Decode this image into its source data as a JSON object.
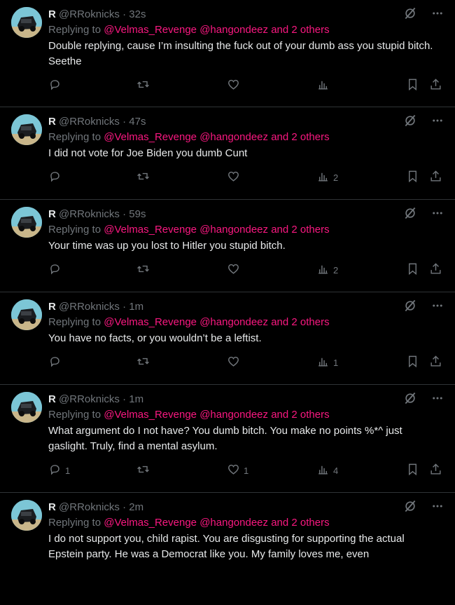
{
  "tweets": [
    {
      "name": "R",
      "handle": "@RRoknicks",
      "sep": "·",
      "time": "32s",
      "replying_prefix": "Replying to",
      "mention1": "@Velmas_Revenge",
      "mention2": "@hangondeez",
      "others": "and 2 others",
      "text": "Double replying, cause I’m insulting the fuck out of your dumb ass you stupid bitch. Seethe",
      "replies": "",
      "likes": "",
      "views": ""
    },
    {
      "name": "R",
      "handle": "@RRoknicks",
      "sep": "·",
      "time": "47s",
      "replying_prefix": "Replying to",
      "mention1": "@Velmas_Revenge",
      "mention2": "@hangondeez",
      "others": "and 2 others",
      "text": "I did not vote for Joe Biden you dumb Cunt",
      "replies": "",
      "likes": "",
      "views": "2"
    },
    {
      "name": "R",
      "handle": "@RRoknicks",
      "sep": "·",
      "time": "59s",
      "replying_prefix": "Replying to",
      "mention1": "@Velmas_Revenge",
      "mention2": "@hangondeez",
      "others": "and 2 others",
      "text": "Your time was up you lost to Hitler you stupid bitch.",
      "replies": "",
      "likes": "",
      "views": "2"
    },
    {
      "name": "R",
      "handle": "@RRoknicks",
      "sep": "·",
      "time": "1m",
      "replying_prefix": "Replying to",
      "mention1": "@Velmas_Revenge",
      "mention2": "@hangondeez",
      "others": "and 2 others",
      "text": "You have no facts, or you wouldn’t be a leftist.",
      "replies": "",
      "likes": "",
      "views": "1"
    },
    {
      "name": "R",
      "handle": "@RRoknicks",
      "sep": "·",
      "time": "1m",
      "replying_prefix": "Replying to",
      "mention1": "@Velmas_Revenge",
      "mention2": "@hangondeez",
      "others": "and 2 others",
      "text": "What argument do I not have? You dumb bitch. You make no points %*^ just gaslight. Truly, find a mental asylum.",
      "replies": "1",
      "likes": "1",
      "views": "4"
    },
    {
      "name": "R",
      "handle": "@RRoknicks",
      "sep": "·",
      "time": "2m",
      "replying_prefix": "Replying to",
      "mention1": "@Velmas_Revenge",
      "mention2": "@hangondeez",
      "others": "and 2 others",
      "text": "I do not support you, child rapist. You are disgusting for supporting the actual Epstein party. He was a Democrat like you. My family loves me, even",
      "replies": "",
      "likes": "",
      "views": ""
    }
  ],
  "icons": {
    "reply": "reply-icon",
    "retweet": "retweet-icon",
    "like": "heart-icon",
    "views": "views-icon",
    "bookmark": "bookmark-icon",
    "share": "share-icon",
    "grok": "grok-icon",
    "more": "more-icon"
  },
  "colors": {
    "background": "#000000",
    "text": "#e7e9ea",
    "muted": "#71767b",
    "mention": "#f91880",
    "border": "#2f3336"
  }
}
